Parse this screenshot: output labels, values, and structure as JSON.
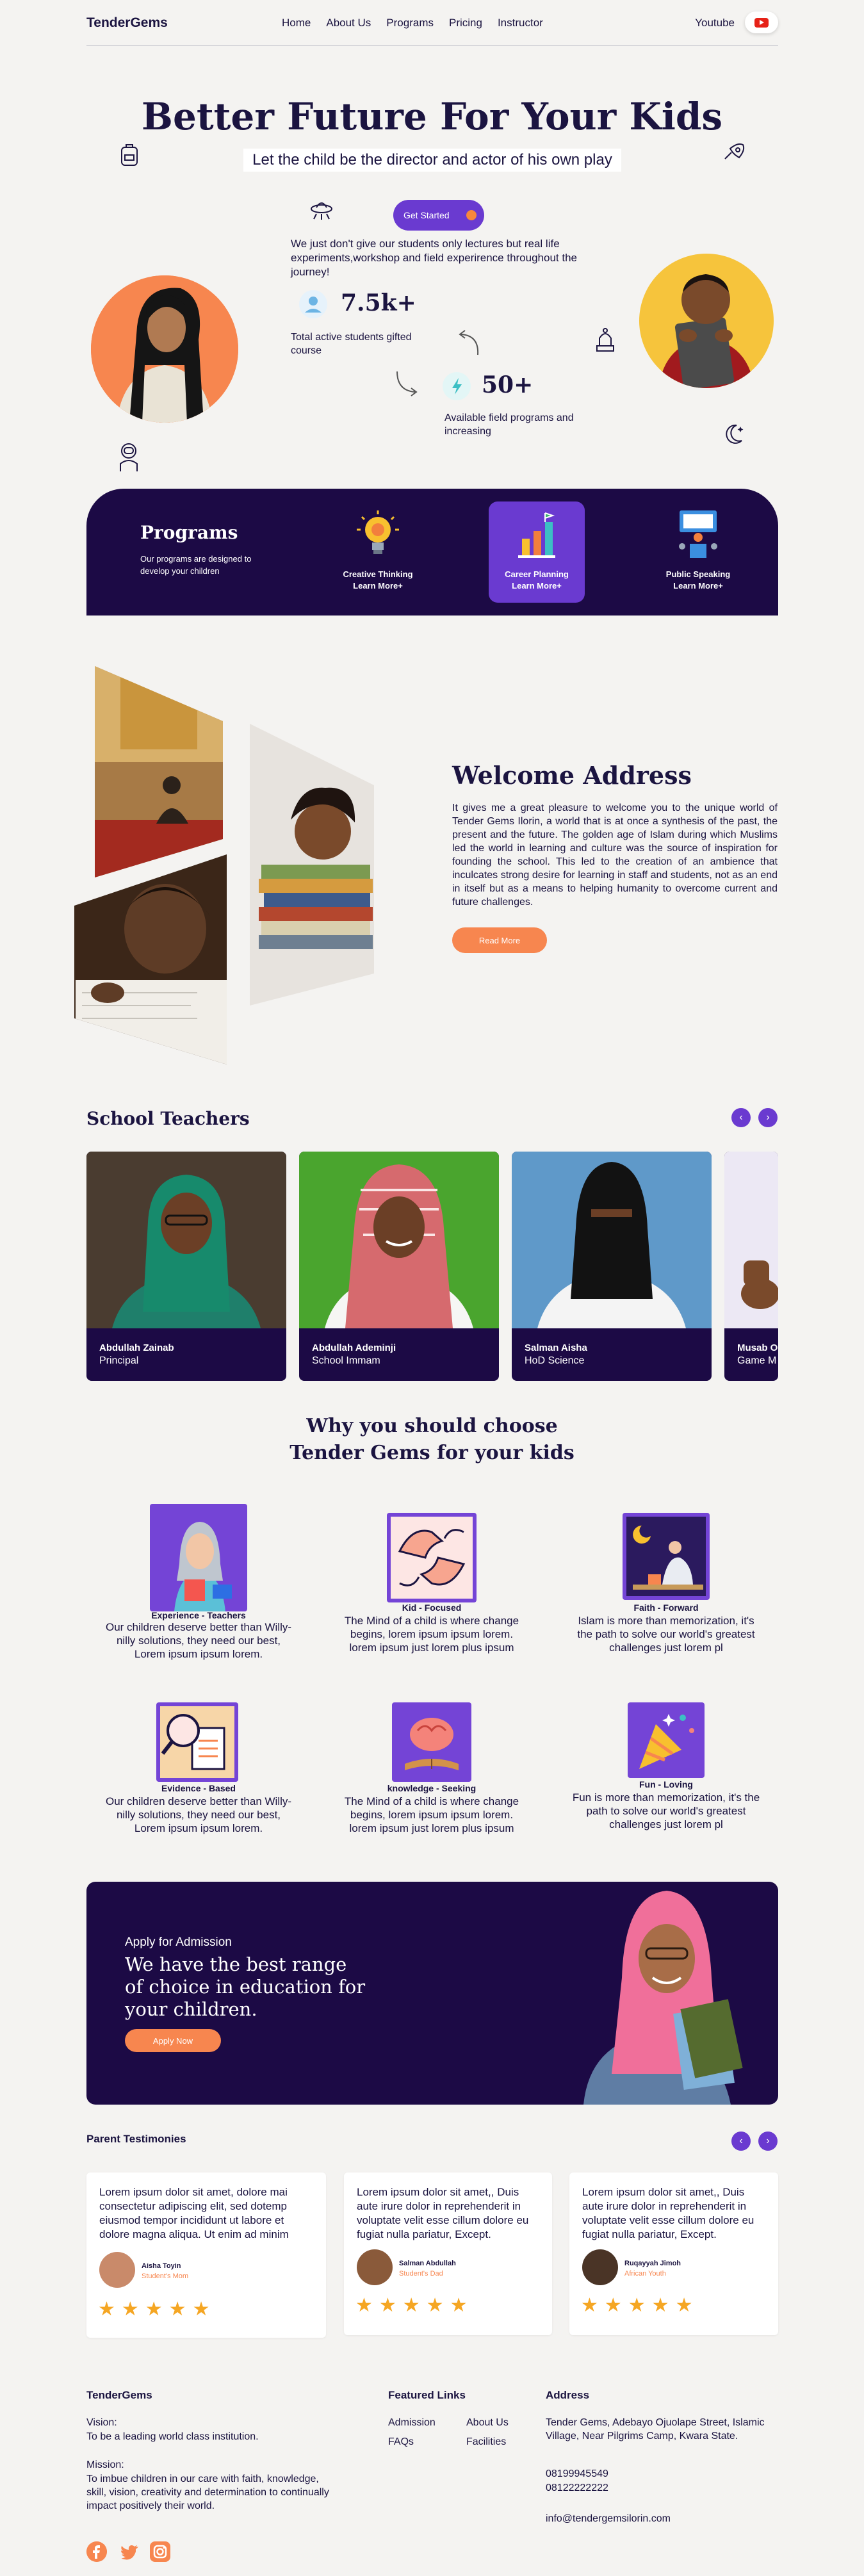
{
  "nav": {
    "brand": "TenderGems",
    "links": [
      "Home",
      "About Us",
      "Programs",
      "Pricing",
      "Instructor"
    ],
    "youtube_label": "Youtube"
  },
  "hero": {
    "title": "Better Future For Your Kids",
    "subtitle": "Let the child be the director and actor of his own play",
    "cta": "Get Started",
    "paragraph": "We just don't give our students only lectures but real life experiments,workshop and field experirence throughout the journey!",
    "stat1": {
      "value": "7.5k+",
      "label": "Total active students gifted course"
    },
    "stat2": {
      "value": "50+",
      "label": "Available field programs and increasing"
    }
  },
  "programs": {
    "title": "Programs",
    "description": "Our programs are designed to develop your children",
    "items": [
      {
        "title": "Creative Thinking",
        "more": "Learn More+"
      },
      {
        "title": "Career Planning",
        "more": "Learn More+"
      },
      {
        "title": "Public Speaking",
        "more": "Learn More+"
      }
    ]
  },
  "welcome": {
    "title": "Welcome Address",
    "text": "It gives me a great pleasure to welcome you to the unique world of Tender Gems Ilorin, a world that is at once a synthesis of the past, the present and the future. The golden age of Islam during which Muslims led the world in learning and culture was the source of inspiration for founding the school. This led to the creation of an ambience that inculcates strong desire for learning in staff and students, not as an end in itself but as a means to helping humanity to overcome current and future challenges.",
    "button": "Read More"
  },
  "teachers": {
    "title": "School Teachers",
    "prev": "‹",
    "next": "›",
    "items": [
      {
        "name": "Abdullah Zainab",
        "role": "Principal"
      },
      {
        "name": "Abdullah Ademinji",
        "role": "School Immam"
      },
      {
        "name": "Salman Aisha",
        "role": "HoD Science"
      },
      {
        "name": "Musab O",
        "role": "Game M"
      }
    ]
  },
  "why": {
    "title_line1": "Why you should choose",
    "title_line2": "Tender Gems for your kids",
    "features": [
      {
        "title": "Experience - Teachers",
        "desc": "Our children deserve better than Willy-nilly solutions, they need our best, Lorem ipsum ipsum lorem."
      },
      {
        "title": "Kid - Focused",
        "desc": "The Mind of a child is where change begins, lorem ipsum ipsum lorem. lorem ipsum just lorem plus ipsum"
      },
      {
        "title": "Faith - Forward",
        "desc": "Islam is more than memorization, it's the path to solve our world's greatest challenges just lorem pl"
      },
      {
        "title": "Evidence - Based",
        "desc": "Our children deserve better than Willy-nilly solutions, they need our best, Lorem ipsum ipsum lorem."
      },
      {
        "title": "knowledge - Seeking",
        "desc": "The Mind of a child is where change begins, lorem ipsum ipsum lorem. lorem ipsum just lorem plus ipsum"
      },
      {
        "title": "Fun - Loving",
        "desc": "Fun is more than memorization, it's the path to solve our world's greatest challenges just lorem pl"
      }
    ]
  },
  "admission": {
    "kicker": "Apply for Admission",
    "headline": "We have the best range of choice in education for your children.",
    "button": "Apply Now"
  },
  "testimonials": {
    "title": "Parent Testimonies",
    "prev": "‹",
    "next": "›",
    "items": [
      {
        "quote": "Lorem ipsum dolor sit amet, dolore mai consectetur adipiscing elit, sed dotemp eiusmod tempor incididunt ut labore et dolore magna aliqua. Ut enim ad minim",
        "name": "Aisha Toyin",
        "role": "Student's Mom",
        "stars": "★★★★★"
      },
      {
        "quote": "Lorem ipsum dolor sit amet,, Duis aute irure dolor in reprehenderit in voluptate velit esse cillum dolore eu fugiat nulla pariatur, Except.",
        "name": "Salman Abdullah",
        "role": "Student's Dad",
        "stars": "★★★★★"
      },
      {
        "quote": "Lorem ipsum dolor sit amet,, Duis aute irure dolor in reprehenderit in voluptate velit esse cillum dolore eu fugiat nulla pariatur, Except.",
        "name": "Ruqayyah Jimoh",
        "role": "African Youth",
        "stars": "★★★★★"
      }
    ]
  },
  "footer": {
    "brand": "TenderGems",
    "vision_label": "Vision:",
    "vision": "To be a leading world class institution.",
    "mission_label": "Mission:",
    "mission": "To imbue children in our care with faith, knowledge, skill, vision, creativity and determination to continually impact positively their world.",
    "featured_title": "Featured Links",
    "links": [
      "Admission",
      "About Us",
      "FAQs",
      "Facilities"
    ],
    "address_title": "Address",
    "address": "Tender Gems, Adebayo Ojuolape Street, Islamic Village, Near Pilgrims Camp, Kwara State.",
    "phone1": "08199945549",
    "phone2": "08122222222",
    "email": "info@tendergemsilorin.com"
  },
  "colors": {
    "primary_dark": "#1c0a45",
    "accent_purple": "#6a3ad0",
    "accent_orange": "#f7864f",
    "background": "#f4f3f1"
  }
}
